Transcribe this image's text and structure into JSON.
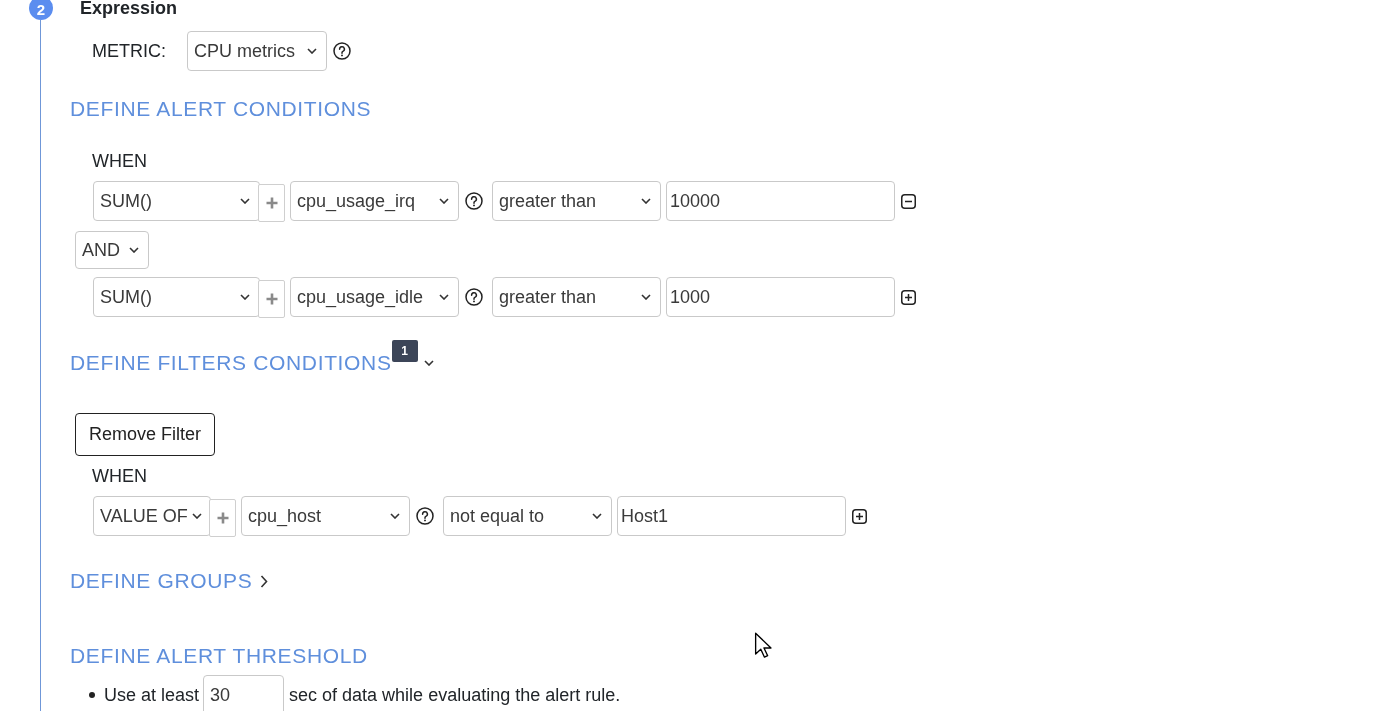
{
  "step": {
    "number": "2",
    "title": "Expression"
  },
  "metric": {
    "label": "METRIC:",
    "value": "CPU metrics"
  },
  "alert_conditions": {
    "heading": "DEFINE ALERT CONDITIONS",
    "when_label": "WHEN",
    "rows": [
      {
        "kind": "condition",
        "aggregate": "SUM()",
        "field": "cpu_usage_irq",
        "operator": "greater than",
        "value": "10000",
        "removable": true
      },
      {
        "kind": "joiner",
        "value": "AND"
      },
      {
        "kind": "condition",
        "aggregate": "SUM()",
        "field": "cpu_usage_idle",
        "operator": "greater than",
        "value": "1000",
        "removable": false
      }
    ]
  },
  "filter_conditions": {
    "heading": "DEFINE FILTERS CONDITIONS",
    "count": "1",
    "expanded": true,
    "remove_button": "Remove Filter",
    "when_label": "WHEN",
    "rows": [
      {
        "kind": "condition",
        "aggregate": "VALUE OF",
        "field": "cpu_host",
        "operator": "not equal to",
        "value": "Host1",
        "removable": false
      }
    ]
  },
  "groups": {
    "heading": "DEFINE GROUPS",
    "expanded": false
  },
  "alert_threshold": {
    "heading": "DEFINE ALERT THRESHOLD",
    "items": [
      {
        "before": "Use at least",
        "value": "30",
        "after": "sec of data while evaluating the alert rule."
      }
    ]
  }
}
